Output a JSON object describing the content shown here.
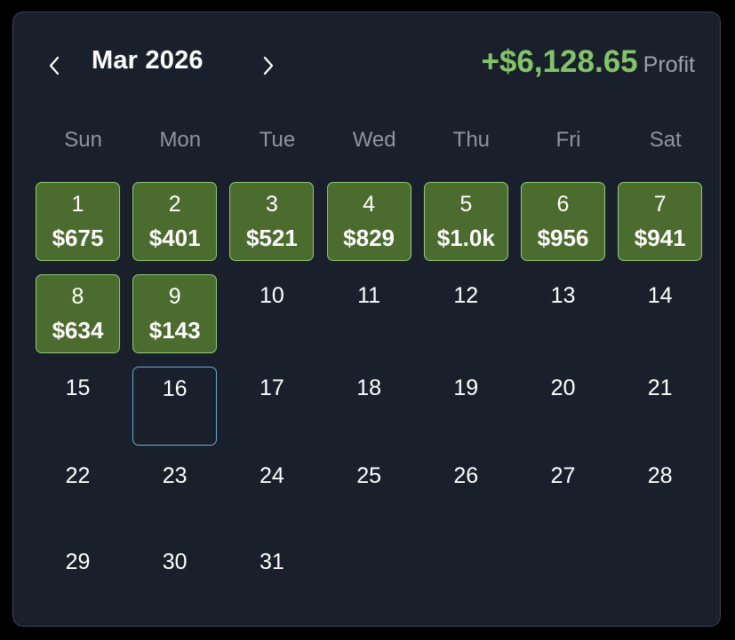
{
  "header": {
    "month_label": "Mar 2026",
    "prev_icon": "chevron-left-icon",
    "next_icon": "chevron-right-icon",
    "profit_value": "+$6,128.65",
    "profit_label": "Profit"
  },
  "weekdays": [
    "Sun",
    "Mon",
    "Tue",
    "Wed",
    "Thu",
    "Fri",
    "Sat"
  ],
  "days": [
    {
      "day": "1",
      "amount": "$675"
    },
    {
      "day": "2",
      "amount": "$401"
    },
    {
      "day": "3",
      "amount": "$521"
    },
    {
      "day": "4",
      "amount": "$829"
    },
    {
      "day": "5",
      "amount": "$1.0k"
    },
    {
      "day": "6",
      "amount": "$956"
    },
    {
      "day": "7",
      "amount": "$941"
    },
    {
      "day": "8",
      "amount": "$634"
    },
    {
      "day": "9",
      "amount": "$143"
    },
    {
      "day": "10"
    },
    {
      "day": "11"
    },
    {
      "day": "12"
    },
    {
      "day": "13"
    },
    {
      "day": "14"
    },
    {
      "day": "15"
    },
    {
      "day": "16",
      "today": true
    },
    {
      "day": "17"
    },
    {
      "day": "18"
    },
    {
      "day": "19"
    },
    {
      "day": "20"
    },
    {
      "day": "21"
    },
    {
      "day": "22"
    },
    {
      "day": "23"
    },
    {
      "day": "24"
    },
    {
      "day": "25"
    },
    {
      "day": "26"
    },
    {
      "day": "27"
    },
    {
      "day": "28"
    },
    {
      "day": "29"
    },
    {
      "day": "30"
    },
    {
      "day": "31"
    }
  ],
  "colors": {
    "background": "#19202b",
    "profit_green": "#83c46a",
    "profit_cell_fill": "#4c6b2e",
    "profit_cell_border": "#8fc975",
    "today_border": "#6aa8d6"
  }
}
